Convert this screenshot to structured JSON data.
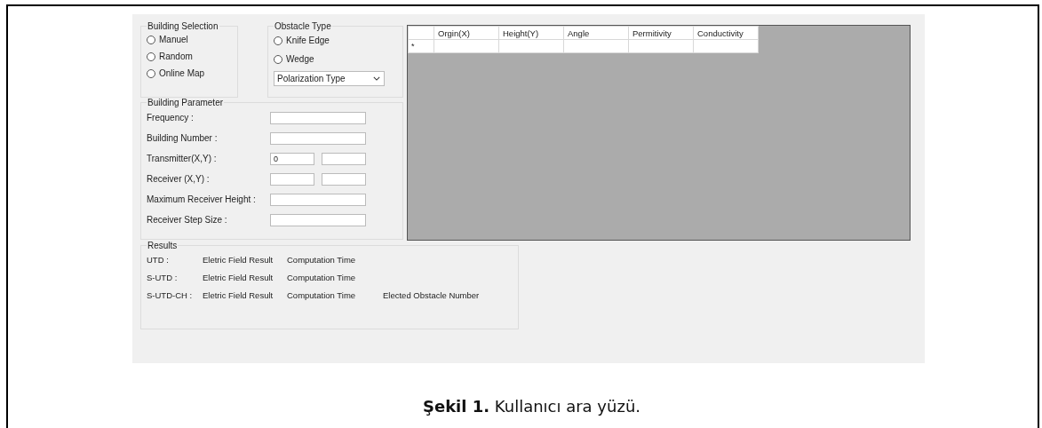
{
  "building_selection": {
    "title": "Building Selection",
    "options": [
      {
        "label": "Manuel",
        "selected": false
      },
      {
        "label": "Random",
        "selected": false
      },
      {
        "label": "Online Map",
        "selected": false
      }
    ]
  },
  "obstacle_type": {
    "title": "Obstacle Type",
    "options": [
      {
        "label": "Knife Edge",
        "selected": false
      },
      {
        "label": "Wedge",
        "selected": false
      }
    ],
    "dropdown": {
      "value": "Polarization Type"
    }
  },
  "building_parameter": {
    "title": "Building Parameter",
    "fields": [
      {
        "label": "Frequency :",
        "kind": "single"
      },
      {
        "label": "Building Number :",
        "kind": "single"
      },
      {
        "label": "Transmitter(X,Y) :",
        "kind": "pair",
        "value": "0"
      },
      {
        "label": "Receiver (X,Y) :",
        "kind": "pair"
      },
      {
        "label": "Maximum Receiver Height :",
        "kind": "single"
      },
      {
        "label": "Receiver Step Size :",
        "kind": "single"
      }
    ]
  },
  "table": {
    "columns": [
      "Orgin(X)",
      "Height(Y)",
      "Angle",
      "Permitivity",
      "Conductivity"
    ],
    "rows": [
      {
        "marker": "*"
      }
    ]
  },
  "results": {
    "title": "Results",
    "rows": [
      {
        "name": "UTD :",
        "cells": [
          "Eletric Field Result",
          "Computation Time"
        ]
      },
      {
        "name": "S-UTD :",
        "cells": [
          "Eletric Field Result",
          "Computation Time"
        ]
      },
      {
        "name": "S-UTD-CH :",
        "cells": [
          "Eletric Field Result",
          "Computation Time",
          "Elected Obstacle Number"
        ]
      }
    ]
  },
  "caption": {
    "label": "Şekil 1.",
    "text": "Kullanıcı ara yüzü."
  }
}
